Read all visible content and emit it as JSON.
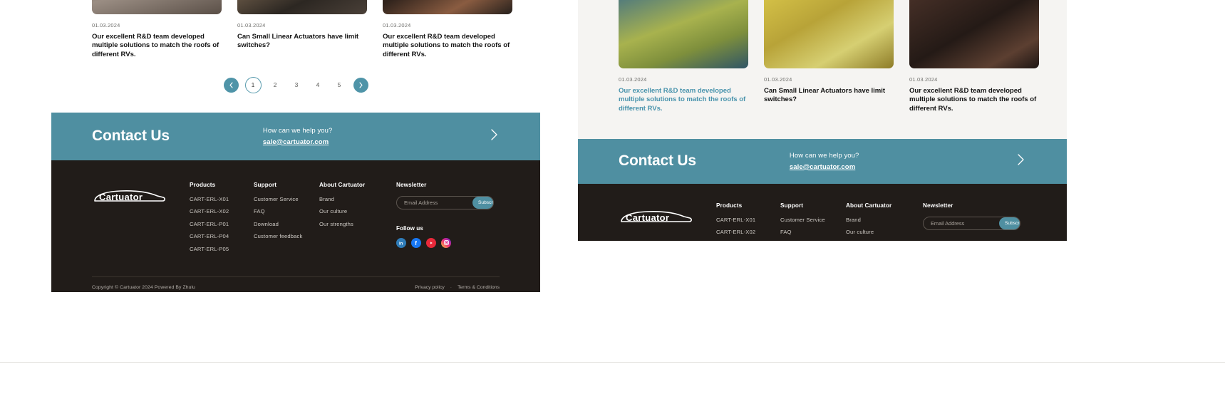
{
  "theme": {
    "accent": "#4f8fa1",
    "accent_light": "#5a9cae",
    "footer_bg": "#211c19",
    "page_bg": "#ffffff",
    "panel_bg": "#f5f4f2",
    "link_muted": "#cdc9c4",
    "highlight_text": "#4a94ad"
  },
  "blog": {
    "cards": [
      {
        "date": "01.03.2024",
        "title": "Our excellent R&D team  developed multiple solutions to match the roofs of different RVs.",
        "thumb": "rocky-terrain-photo",
        "highlight": false
      },
      {
        "date": "01.03.2024",
        "title": "Can Small Linear Actuators have limit switches?",
        "thumb": "offroad-vehicle-photo",
        "highlight": false
      },
      {
        "date": "01.03.2024",
        "title": "Our excellent R&D team  developed multiple solutions to match the roofs of different RVs.",
        "thumb": "muddy-tire-photo",
        "highlight": false
      }
    ],
    "cards_right": [
      {
        "date": "01.03.2024",
        "title": "Our excellent R&D team  developed multiple solutions to match the roofs of different RVs.",
        "thumb": "lake-landscape-photo",
        "highlight": true
      },
      {
        "date": "01.03.2024",
        "title": "Can Small Linear Actuators have limit switches?",
        "thumb": "yellow-field-photo",
        "highlight": false
      },
      {
        "date": "01.03.2024",
        "title": "Our excellent R&D team  developed multiple solutions to match the roofs of different RVs.",
        "thumb": "dark-offroad-photo",
        "highlight": false
      }
    ]
  },
  "pagination": {
    "prev_icon": "chevron-left-icon",
    "next_icon": "chevron-right-icon",
    "pages": [
      "1",
      "2",
      "3",
      "4",
      "5"
    ],
    "active_page": "1"
  },
  "contact": {
    "title": "Contact Us",
    "help_question": "How can we help you?",
    "email": "sale@cartuator.com",
    "arrow_icon": "chevron-right-icon"
  },
  "footer": {
    "logo_text": "Cartuator",
    "logo_icon": "car-outline-logo",
    "columns": [
      {
        "heading": "Products",
        "links": [
          "CART-ERL-X01",
          "CART-ERL-X02",
          "CART-ERL-P01",
          "CART-ERL-P04",
          "CART-ERL-P05"
        ]
      },
      {
        "heading": "Support",
        "links": [
          "Customer Service",
          "FAQ",
          "Download",
          "Customer feedback"
        ]
      },
      {
        "heading": "About Cartuator",
        "links": [
          "Brand",
          "Our culture",
          "Our strengths"
        ]
      }
    ],
    "newsletter": {
      "heading": "Newsletter",
      "placeholder": "Email Address",
      "value": "",
      "subscribe_label": "Subscribe"
    },
    "follow": {
      "heading": "Follow us",
      "socials": [
        "linkedin-icon",
        "facebook-icon",
        "youtube-icon",
        "instagram-icon"
      ]
    },
    "copyright": "Copyright © Cartuator 2024  Powered By Zhulu",
    "legal": {
      "privacy": "Privacy policy",
      "separator": "·",
      "terms": "Terms & Conditions"
    }
  }
}
